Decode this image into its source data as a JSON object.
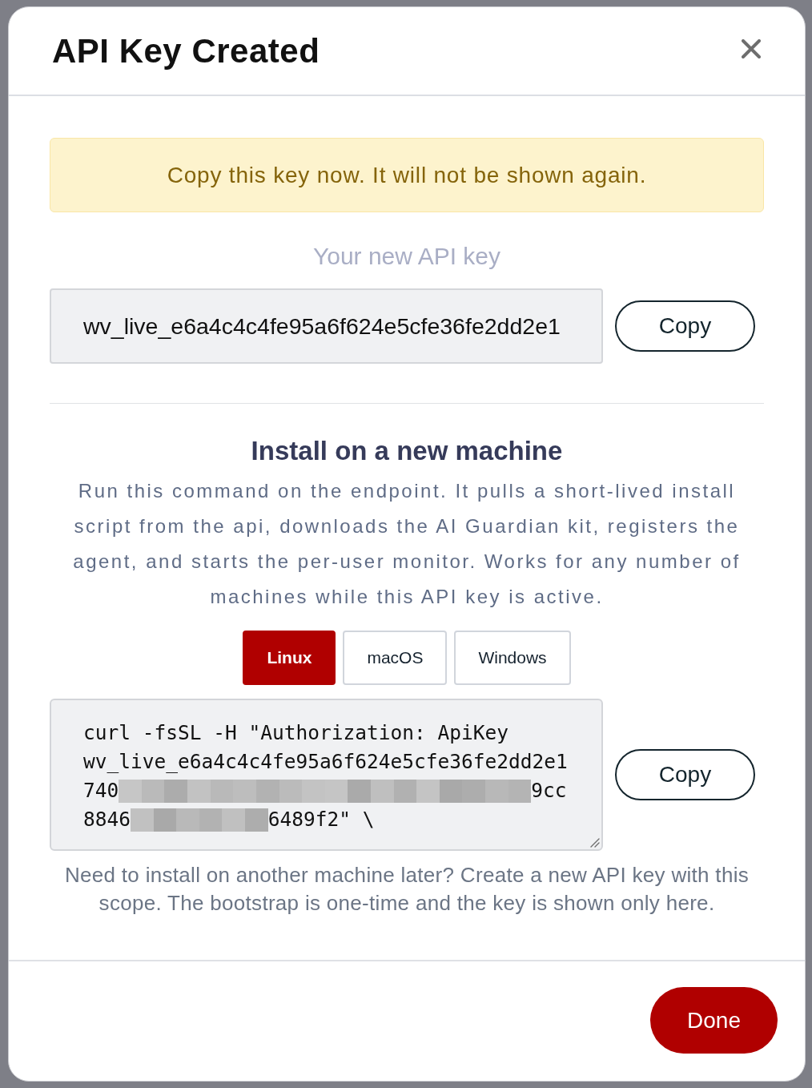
{
  "dialog": {
    "title": "API Key Created"
  },
  "alert": {
    "text": "Copy this key now. It will not be shown again."
  },
  "key": {
    "label": "Your new API key",
    "value": "wv_live_e6a4c4c4fe95a6f624e5cfe36fe2dd2e1",
    "copy_button": "Copy"
  },
  "install": {
    "heading": "Install on a new machine",
    "description": "Run this command on the endpoint. It pulls a short-lived install script from the api, downloads the AI Guardian kit, registers the agent, and starts the per-user monitor. Works for any number of machines while this API key is active.",
    "tabs": [
      {
        "label": "Linux",
        "selected": true
      },
      {
        "label": "macOS",
        "selected": false
      },
      {
        "label": "Windows",
        "selected": false
      }
    ],
    "command": {
      "lines": [
        {
          "segments": [
            {
              "kind": "text",
              "text": "curl -fsSL -H \"Authorization: ApiKey"
            }
          ]
        },
        {
          "segments": [
            {
              "kind": "text",
              "text": "wv_live_e6a4c4c4fe95a6f624e5cfe36fe2dd2e1"
            }
          ]
        },
        {
          "segments": [
            {
              "kind": "text",
              "text": "740"
            },
            {
              "kind": "redacted",
              "tiles": [
                {
                  "color": "#c6c6c6"
                },
                {
                  "color": "#bababa"
                },
                {
                  "color": "#acacac"
                },
                {
                  "color": "#c2c2c2"
                },
                {
                  "color": "#b9b9b9"
                },
                {
                  "color": "#bdbdbd"
                },
                {
                  "color": "#b2b2b2"
                },
                {
                  "color": "#bbbbbb"
                },
                {
                  "color": "#c3c3c3"
                },
                {
                  "color": "#c5c5c5"
                },
                {
                  "color": "#aaaaaa"
                },
                {
                  "color": "#bfbfbf"
                },
                {
                  "color": "#b1b1b1"
                },
                {
                  "color": "#c4c4c4"
                },
                {
                  "color": "#a9a9a9"
                },
                {
                  "color": "#adadad"
                },
                {
                  "color": "#b8b8b8"
                },
                {
                  "color": "#b4b4b4"
                }
              ]
            },
            {
              "kind": "text",
              "text": "9cc"
            }
          ]
        },
        {
          "segments": [
            {
              "kind": "text",
              "text": "8846"
            },
            {
              "kind": "redacted",
              "tiles": [
                {
                  "color": "#c1c1c1"
                },
                {
                  "color": "#a9a9a9"
                },
                {
                  "color": "#b9b9b9"
                },
                {
                  "color": "#b2b2b2"
                },
                {
                  "color": "#c0c0c0"
                },
                {
                  "color": "#adadad"
                }
              ]
            },
            {
              "kind": "text",
              "text": "6489f2\" \\"
            }
          ]
        }
      ]
    },
    "copy_button": "Copy",
    "note": "Need to install on another machine later? Create a new API key with this scope. The bootstrap is one-time and the key is shown only here."
  },
  "footer": {
    "done_button": "Done"
  }
}
